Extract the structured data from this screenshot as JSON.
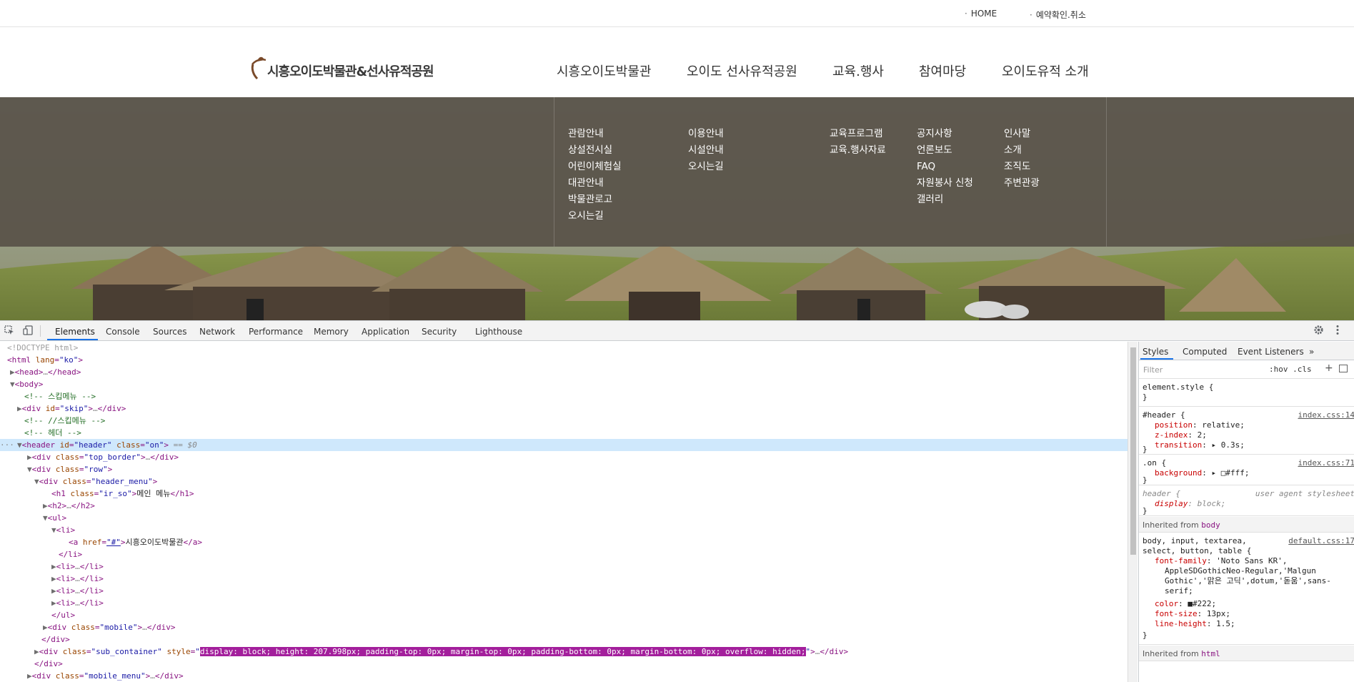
{
  "site": {
    "top_links": [
      "HOME",
      "예약확인.취소"
    ],
    "logo_text": "시흥오이도박물관&선사유적공원",
    "nav": [
      "시흥오이도박물관",
      "오이도 선사유적공원",
      "교육.행사",
      "참여마당",
      "오이도유적 소개"
    ],
    "submenu": [
      [
        "관람안내",
        "상설전시실",
        "어린이체험실",
        "대관안내",
        "박물관로고",
        "오시는길"
      ],
      [
        "이용안내",
        "시설안내",
        "오시는길"
      ],
      [
        "교육프로그램",
        "교육.행사자료"
      ],
      [
        "공지사항",
        "언론보도",
        "FAQ",
        "자원봉사 신청",
        "갤러리"
      ],
      [
        "인사말",
        "소개",
        "조직도",
        "주변관광"
      ]
    ]
  },
  "devtools": {
    "tabs": [
      "Elements",
      "Console",
      "Sources",
      "Network",
      "Performance",
      "Memory",
      "Application",
      "Security",
      "Lighthouse"
    ],
    "active_tab": "Elements",
    "styles_tabs": [
      "Styles",
      "Computed",
      "Event Listeners",
      "»"
    ],
    "filter_placeholder": "Filter",
    "filter_buttons": ":hov  .cls",
    "dom": {
      "doctype": "<!DOCTYPE html>",
      "html_open": "html",
      "lang_attr": "lang",
      "lang_val": "\"ko\"",
      "head": "head",
      "body": "body",
      "c1": "<!-- 스킵메뉴 -->",
      "skip_id": "\"skip\"",
      "c2": "<!-- //스킵메뉴 -->",
      "c3": "<!-- 헤더 -->",
      "header_id": "\"header\"",
      "header_class": "\"on\"",
      "header_eq": " == $0",
      "top_border": "\"top_border\"",
      "row": "\"row\"",
      "header_menu": "\"header_menu\"",
      "h1_class": "\"ir_so\"",
      "h1_text": "메인 메뉴",
      "a_href": "\"#\"",
      "a_text": "시흥오이도박물관",
      "mobile": "\"mobile\"",
      "sub_container": "\"sub_container\"",
      "style_val": "display: block; height: 207.998px; padding-top: 0px; margin-top: 0px; padding-bottom: 0px; margin-bottom: 0px; overflow: hidden;",
      "mobile_menu": "\"mobile_menu\""
    },
    "styles": {
      "element_style": "element.style {",
      "header_selector": "#header {",
      "header_src": "index.css:14",
      "header_props": [
        [
          "position",
          "relative;"
        ],
        [
          "z-index",
          "2;"
        ],
        [
          "transition",
          "▸ 0.3s;"
        ]
      ],
      "on_selector": ".on {",
      "on_src": "index.css:71",
      "on_props": [
        [
          "background",
          "▸ □#fff;"
        ]
      ],
      "ua_selector": "header {",
      "ua_src": "user agent stylesheet",
      "ua_props": [
        [
          "display",
          "block;"
        ]
      ],
      "inherited_body": "Inherited from",
      "body_tag": "body",
      "body_selector": "body, input, textarea,",
      "body_selector2": "select, button, table {",
      "body_src": "default.css:17",
      "font_family": "font-family",
      "font_family_val1": "'Noto Sans KR',",
      "font_family_val2": "AppleSDGothicNeo-Regular,'Malgun",
      "font_family_val3": "Gothic','맑은 고딕',dotum,'돋움',sans-",
      "font_family_val4": "serif;",
      "color_prop": "color",
      "color_val": "■#222;",
      "font_size_prop": "font-size",
      "font_size_val": "13px;",
      "line_height_prop": "line-height",
      "line_height_val": "1.5;",
      "inherited_html": "html"
    }
  }
}
